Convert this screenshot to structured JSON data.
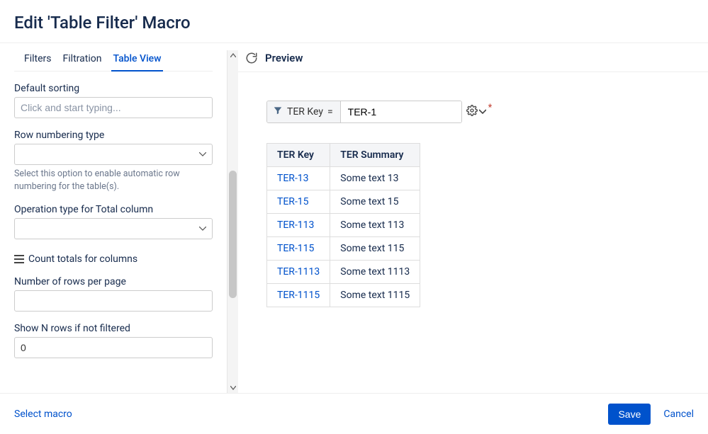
{
  "header": {
    "title": "Edit 'Table Filter' Macro"
  },
  "tabs": {
    "items": [
      "Filters",
      "Filtration",
      "Table View"
    ],
    "activeIndex": 2
  },
  "sidebar": {
    "defaultSorting": {
      "label": "Default sorting",
      "placeholder": "Click and start typing..."
    },
    "rowNumbering": {
      "label": "Row numbering type",
      "hint": "Select this option to enable automatic row numbering for the table(s)."
    },
    "operationType": {
      "label": "Operation type for Total column"
    },
    "countTotals": {
      "label": "Count totals for columns"
    },
    "rowsPerPage": {
      "label": "Number of rows per page",
      "value": ""
    },
    "showNRows": {
      "label": "Show N rows if not filtered",
      "value": "0"
    }
  },
  "preview": {
    "title": "Preview",
    "filter": {
      "field": "TER Key",
      "op": "=",
      "value": "TER-1"
    },
    "table": {
      "headers": [
        "TER Key",
        "TER Summary"
      ],
      "rows": [
        {
          "key": "TER-13",
          "summary": "Some text 13"
        },
        {
          "key": "TER-15",
          "summary": "Some text 15"
        },
        {
          "key": "TER-113",
          "summary": "Some text 113"
        },
        {
          "key": "TER-115",
          "summary": "Some text 115"
        },
        {
          "key": "TER-1113",
          "summary": "Some text 1113"
        },
        {
          "key": "TER-1115",
          "summary": "Some text 1115"
        }
      ]
    }
  },
  "footer": {
    "selectMacro": "Select macro",
    "save": "Save",
    "cancel": "Cancel"
  }
}
